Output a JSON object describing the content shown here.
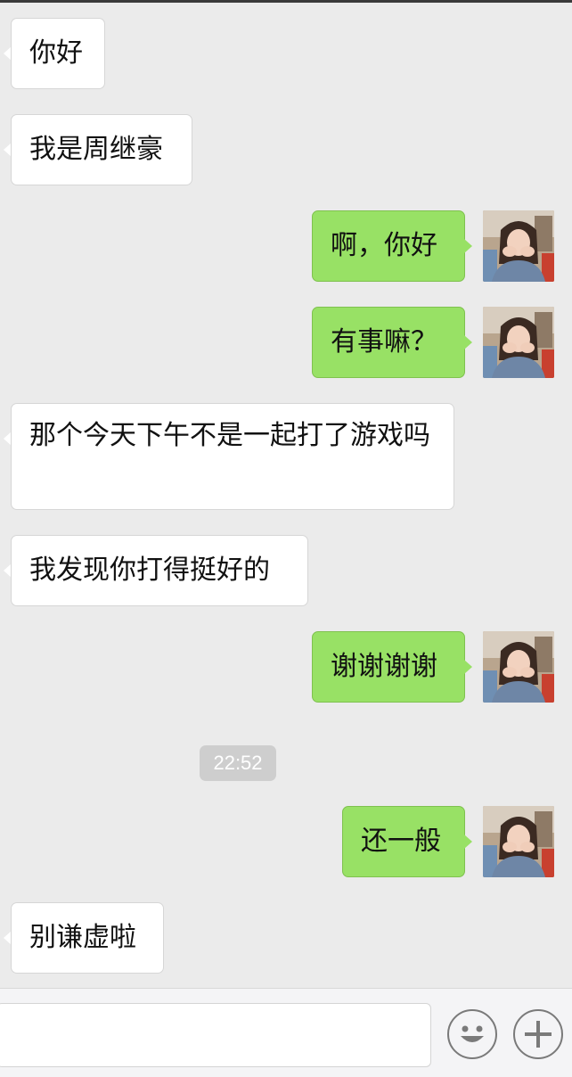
{
  "messages": [
    {
      "side": "left",
      "text": "你好"
    },
    {
      "side": "left",
      "text": "我是周继豪"
    },
    {
      "side": "right",
      "text": "啊，你好"
    },
    {
      "side": "right",
      "text": "有事嘛？"
    },
    {
      "side": "left",
      "text": "那个今天下午不是一起打了游戏吗"
    },
    {
      "side": "left",
      "text": "我发现你打得挺好的"
    },
    {
      "side": "right",
      "text": "谢谢谢谢"
    },
    {
      "side": "right",
      "text": "还一般"
    },
    {
      "side": "left",
      "text": "别谦虚啦"
    }
  ],
  "timestamp": "22:52",
  "input": {
    "placeholder": "",
    "value": ""
  },
  "icons": {
    "emoji": "emoji-smile-icon",
    "plus": "plus-icon"
  },
  "colors": {
    "background": "#ebebeb",
    "sent_bubble": "#98e165",
    "received_bubble": "#ffffff"
  }
}
